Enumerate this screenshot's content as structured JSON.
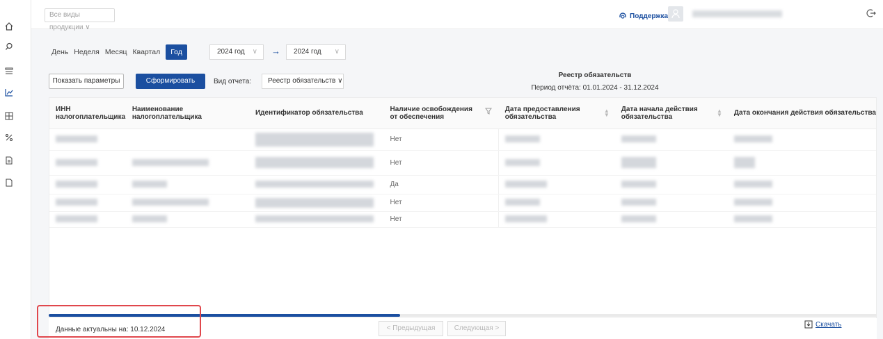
{
  "sidebar": {
    "icons": [
      "home-icon",
      "search-icon",
      "list-icon",
      "chart-icon",
      "grid-icon",
      "percent-icon",
      "document-icon",
      "file-icon"
    ]
  },
  "topbar": {
    "product_select": "Все виды продукции",
    "support_label": "Поддержка"
  },
  "period": {
    "tabs": [
      "День",
      "Неделя",
      "Месяц",
      "Квартал"
    ],
    "active_tab": "Год",
    "from_year": "2024 год",
    "to_year": "2024 год"
  },
  "controls": {
    "show_params": "Показать параметры",
    "generate": "Сформировать",
    "report_type_label": "Вид отчета:",
    "report_type_value": "Реестр обязательств"
  },
  "report": {
    "title": "Реестр обязательств",
    "period": "Период отчёта: 01.01.2024 - 31.12.2024"
  },
  "table": {
    "columns": [
      "ИНН налогоплательщика",
      "Наименование налогоплательщика",
      "Идентификатор обязательства",
      "Наличие освобождения от обеспечения",
      "Дата предоставления обязательства",
      "Дата начала действия обязательства",
      "Дата окончания действия обязательства"
    ],
    "rows": [
      {
        "exemption": "Нет"
      },
      {
        "exemption": "Нет"
      },
      {
        "exemption": "Да"
      },
      {
        "exemption": "Нет"
      },
      {
        "exemption": "Нет"
      }
    ]
  },
  "footer": {
    "actual_label": "Данные актуальны на: 10.12.2024",
    "prev": "< Предыдущая",
    "next": "Следующая >",
    "download": "Скачать"
  },
  "colors": {
    "primary": "#1b4fa0",
    "highlight": "#e0474c"
  }
}
